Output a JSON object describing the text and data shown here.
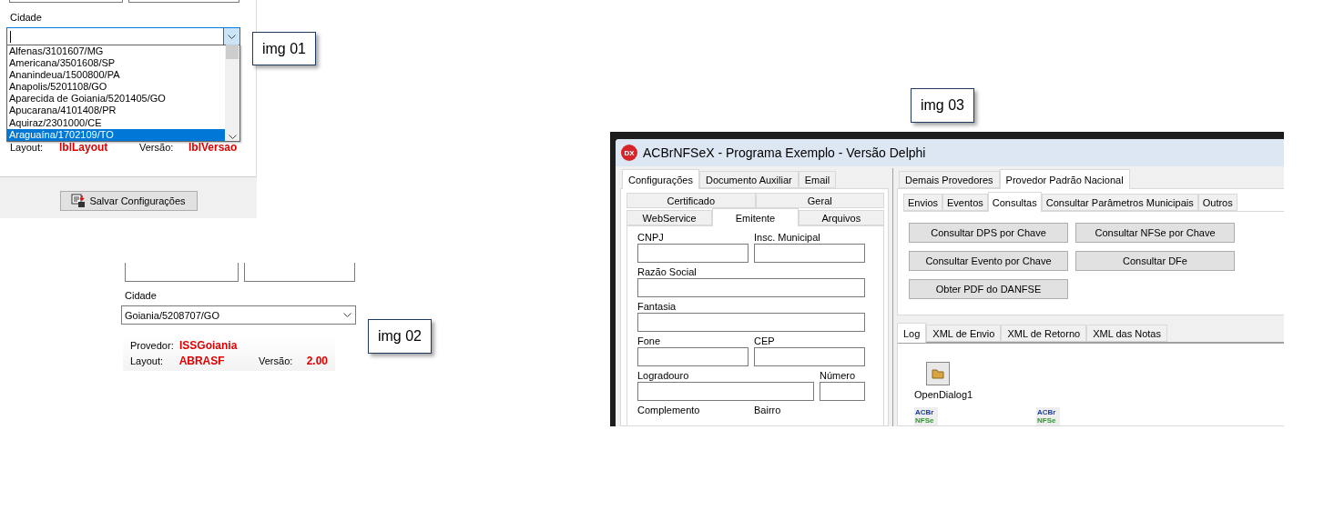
{
  "img01": {
    "caption": "img 01",
    "city_label": "Cidade",
    "dropdown_items": [
      {
        "label": "Alfenas/3101607/MG",
        "selected": false
      },
      {
        "label": "Americana/3501608/SP",
        "selected": false
      },
      {
        "label": "Ananindeua/1500800/PA",
        "selected": false
      },
      {
        "label": "Anapolis/5201108/GO",
        "selected": false
      },
      {
        "label": "Aparecida de Goiania/5201405/GO",
        "selected": false
      },
      {
        "label": "Apucarana/4101408/PR",
        "selected": false
      },
      {
        "label": "Aquiraz/2301000/CE",
        "selected": false
      },
      {
        "label": "Araguaína/1702109/TO",
        "selected": true
      }
    ],
    "layout_label": "Layout:",
    "layout_value": "lblLayout",
    "version_label": "Versão:",
    "version_value": "lblVersao",
    "save_button": "Salvar Configurações"
  },
  "img02": {
    "caption": "img 02",
    "city_label": "Cidade",
    "city_value": "Goiania/5208707/GO",
    "provider_label": "Provedor:",
    "provider_value": "ISSGoiania",
    "layout_label": "Layout:",
    "layout_value": "ABRASF",
    "version_label": "Versão:",
    "version_value": "2.00"
  },
  "img03": {
    "caption": "img 03",
    "window_title": "ACBrNFSeX - Programa Exemplo - Versão Delphi",
    "app_icon_text": "DX",
    "left_tabs": [
      {
        "label": "Configurações",
        "selected": true
      },
      {
        "label": "Documento Auxiliar",
        "selected": false
      },
      {
        "label": "Email",
        "selected": false
      }
    ],
    "config_tab_rows": [
      [
        {
          "label": "Certificado",
          "selected": false
        },
        {
          "label": "Geral",
          "selected": false
        }
      ],
      [
        {
          "label": "WebService",
          "selected": false
        },
        {
          "label": "Emitente",
          "selected": true
        },
        {
          "label": "Arquivos",
          "selected": false
        }
      ]
    ],
    "form_rows": [
      {
        "kind": "pair",
        "labels": [
          "CNPJ",
          "Insc. Municipal"
        ]
      },
      {
        "kind": "full",
        "labels": [
          "Razão Social"
        ]
      },
      {
        "kind": "full",
        "labels": [
          "Fantasia"
        ]
      },
      {
        "kind": "pair",
        "labels": [
          "Fone",
          "CEP"
        ]
      },
      {
        "kind": "wide_narrow",
        "labels": [
          "Logradouro",
          "Número"
        ]
      },
      {
        "kind": "labels",
        "labels": [
          "Complemento",
          "Bairro"
        ]
      }
    ],
    "provider_tabs": [
      {
        "label": "Demais Provedores",
        "selected": false
      },
      {
        "label": "Provedor Padrão Nacional",
        "selected": true
      }
    ],
    "action_tabs": [
      {
        "label": "Envios",
        "selected": false
      },
      {
        "label": "Eventos",
        "selected": false
      },
      {
        "label": "Consultas",
        "selected": true
      },
      {
        "label": "Consultar Parâmetros Municipais",
        "selected": false
      },
      {
        "label": "Outros",
        "selected": false
      }
    ],
    "buttons": [
      "Consultar DPS por Chave",
      "Consultar NFSe por Chave",
      "Consultar Evento por Chave",
      "Consultar DFe",
      "Obter PDF do DANFSE"
    ],
    "log_tabs": [
      {
        "label": "Log",
        "selected": true
      },
      {
        "label": "XML de Envio",
        "selected": false
      },
      {
        "label": "XML de Retorno",
        "selected": false
      },
      {
        "label": "XML das Notas",
        "selected": false
      }
    ],
    "components": [
      {
        "kind": "dialog",
        "label": "OpenDialog1"
      },
      {
        "kind": "logo",
        "logo_top": "ACBr",
        "logo_bottom": "NFSe"
      },
      {
        "kind": "logo",
        "logo_top": "ACBr",
        "logo_bottom": "NFSe"
      }
    ]
  }
}
